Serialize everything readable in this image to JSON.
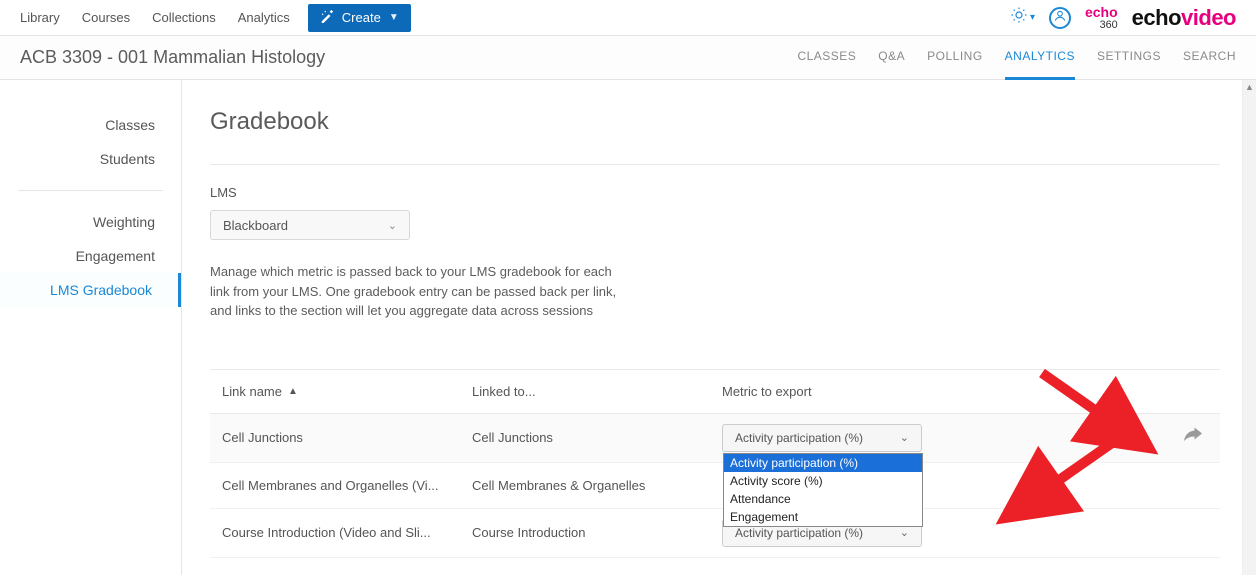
{
  "topnav": {
    "items": [
      "Library",
      "Courses",
      "Collections",
      "Analytics"
    ],
    "create_label": "Create"
  },
  "brand": {
    "small": "echo",
    "small_sub": "360",
    "logo_echo": "echo",
    "logo_video": "video"
  },
  "course": {
    "title": "ACB 3309 - 001 Mammalian Histology"
  },
  "section_tabs": [
    "CLASSES",
    "Q&A",
    "POLLING",
    "ANALYTICS",
    "SETTINGS",
    "SEARCH"
  ],
  "section_active": "ANALYTICS",
  "sidebar": {
    "group1": [
      "Classes",
      "Students"
    ],
    "group2": [
      "Weighting",
      "Engagement",
      "LMS Gradebook"
    ],
    "active": "LMS Gradebook"
  },
  "page": {
    "title": "Gradebook",
    "lms_label": "LMS",
    "lms_value": "Blackboard",
    "help": "Manage which metric is passed back to your LMS gradebook for each link from your LMS. One gradebook entry can be passed back per link, and links to the section will let you aggregate data across sessions"
  },
  "table": {
    "headers": {
      "link_name": "Link name",
      "linked_to": "Linked to...",
      "metric": "Metric to export"
    },
    "rows": [
      {
        "link_name": "Cell Junctions",
        "linked_to": "Cell Junctions",
        "metric": "Activity participation (%)",
        "share": true,
        "open": true
      },
      {
        "link_name": "Cell Membranes and Organelles (Vi...",
        "linked_to": "Cell Membranes & Organelles",
        "metric": "",
        "share": false,
        "open": false
      },
      {
        "link_name": "Course Introduction (Video and Sli...",
        "linked_to": "Course Introduction",
        "metric": "Activity participation (%)",
        "share": false,
        "open": false
      }
    ],
    "dropdown_options": [
      "Activity participation (%)",
      "Activity score (%)",
      "Attendance",
      "Engagement"
    ]
  }
}
